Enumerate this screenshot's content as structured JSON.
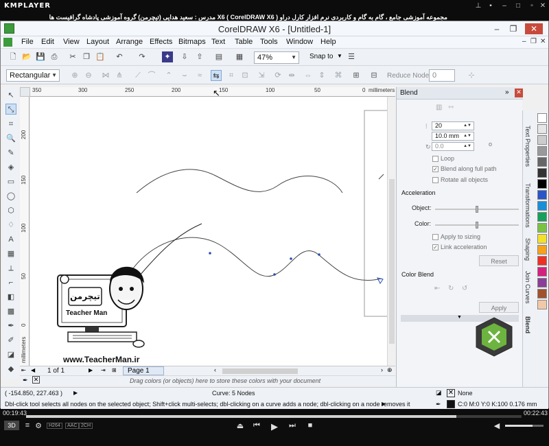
{
  "player": {
    "logo": "KMPLAYER",
    "caption": "مجموعه آموزشی جامع ، گام به گام و کاربردی نرم افزار کارل دراو X6 ( CorelDRAW X6 ) مدرس : سعید هدایی (تیچرمن) گروه آموزشی پادشاه گرافیست ها",
    "time_elapsed": "00:19:43",
    "time_total": "00:22:43",
    "progress": 0.868,
    "badge_3d": "3D",
    "codec_labels": [
      "H264",
      "AAC",
      "2CH"
    ]
  },
  "app": {
    "title": "CorelDRAW X6 - [Untitled-1]",
    "menu": [
      "File",
      "Edit",
      "View",
      "Layout",
      "Arrange",
      "Effects",
      "Bitmaps",
      "Text",
      "Table",
      "Tools",
      "Window",
      "Help"
    ],
    "zoom": "47%",
    "snap_to": "Snap to",
    "shape_combo": "Rectangular",
    "reduce_nodes_label": "Reduce Nodes",
    "reduce_nodes_value": "0",
    "ruler_units": "millimeters",
    "ruler_h_labels": [
      "350",
      "300",
      "250",
      "200",
      "150",
      "100",
      "50",
      "0"
    ],
    "ruler_v_labels": [
      "200",
      "150",
      "100",
      "50",
      "0"
    ],
    "page_nav": "1 of 1",
    "page_tab": "Page 1",
    "palette_hint": "Drag colors (or objects) here to store these colors with your document"
  },
  "docker": {
    "title": "Blend",
    "steps": "20",
    "spacing": "10.0 mm",
    "rotation": "0.0",
    "degree_sign": "o",
    "loop_label": "Loop",
    "loop_checked": false,
    "blend_full_path_label": "Blend along full path",
    "blend_full_path_checked": true,
    "rotate_all_label": "Rotate all objects",
    "rotate_all_checked": false,
    "acceleration_label": "Acceleration",
    "object_label": "Object:",
    "color_label": "Color:",
    "object_accel": 0.5,
    "color_accel": 0.5,
    "apply_sizing_label": "Apply to sizing",
    "apply_sizing_checked": false,
    "link_accel_label": "Link acceleration",
    "link_accel_checked": true,
    "reset_label": "Reset",
    "color_blend_label": "Color Blend",
    "apply_label": "Apply"
  },
  "side_tabs": [
    "Text Properties",
    "Transformations",
    "Shaping",
    "Join Curves",
    "Blend"
  ],
  "palette_colors": [
    "#ffffff",
    "#e6e6e6",
    "#cccccc",
    "#999999",
    "#666666",
    "#333333",
    "#000000",
    "#2a55c8",
    "#1a8fd8",
    "#17a05a",
    "#7cc242",
    "#f3e12a",
    "#f7a21b",
    "#ee3124",
    "#d5217e",
    "#8b3f98",
    "#a0522d",
    "#f2c9a8"
  ],
  "status": {
    "coords": "( -154.850, 227.463 )",
    "curve_info": "Curve: 5 Nodes",
    "hint": "Dbl-click tool selects all nodes on the selected object; Shift+click multi-selects; dbl-clicking on a curve adds a node; dbl-clicking on a node removes it",
    "fill": "None",
    "outline": "C:0 M:0 Y:0 K:100  0.176 mm"
  },
  "watermark": {
    "site": "www.TeacherMan.ir",
    "brand": "Teacher Man",
    "brand_fa": "تیچرمن"
  }
}
